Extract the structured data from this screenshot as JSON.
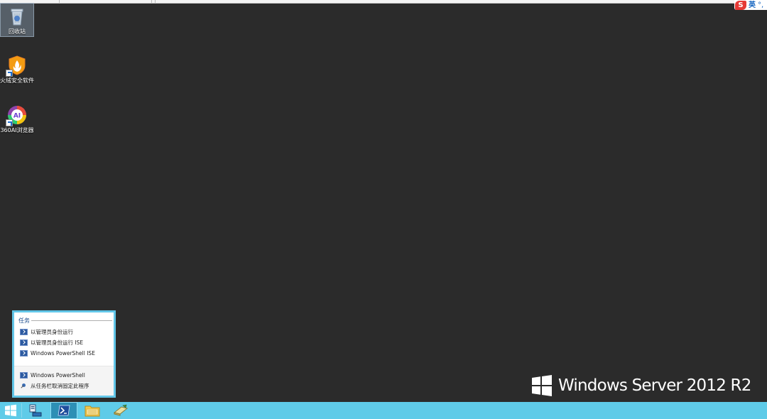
{
  "desktop": {
    "icons": [
      {
        "label": "回收站",
        "icon": "recycle-bin-icon"
      },
      {
        "label": "火绒安全软件",
        "icon": "huorong-shield-icon"
      },
      {
        "label": "360AI浏览器",
        "icon": "360ai-browser-icon"
      }
    ],
    "background_color": "#2b2b2b"
  },
  "ime": {
    "logo": "S",
    "mode": "英",
    "extra": "°,"
  },
  "jumplist": {
    "header": "任务",
    "items": [
      {
        "label": "以管理员身份运行",
        "icon": "powershell-icon"
      },
      {
        "label": "以管理员身份运行 ISE",
        "icon": "powershell-ise-icon"
      },
      {
        "label": "Windows PowerShell ISE",
        "icon": "powershell-ise-icon"
      }
    ],
    "footer": [
      {
        "label": "Windows PowerShell",
        "icon": "powershell-icon"
      },
      {
        "label": "从任务栏取消固定此程序",
        "icon": "unpin-icon"
      }
    ],
    "accent": "#62c6e8"
  },
  "watermark": {
    "text": "Windows Server 2012 R2"
  },
  "taskbar": {
    "color": "#5fcbe8",
    "items": [
      "start-button",
      "server-manager",
      "powershell",
      "file-explorer",
      "tool"
    ]
  }
}
